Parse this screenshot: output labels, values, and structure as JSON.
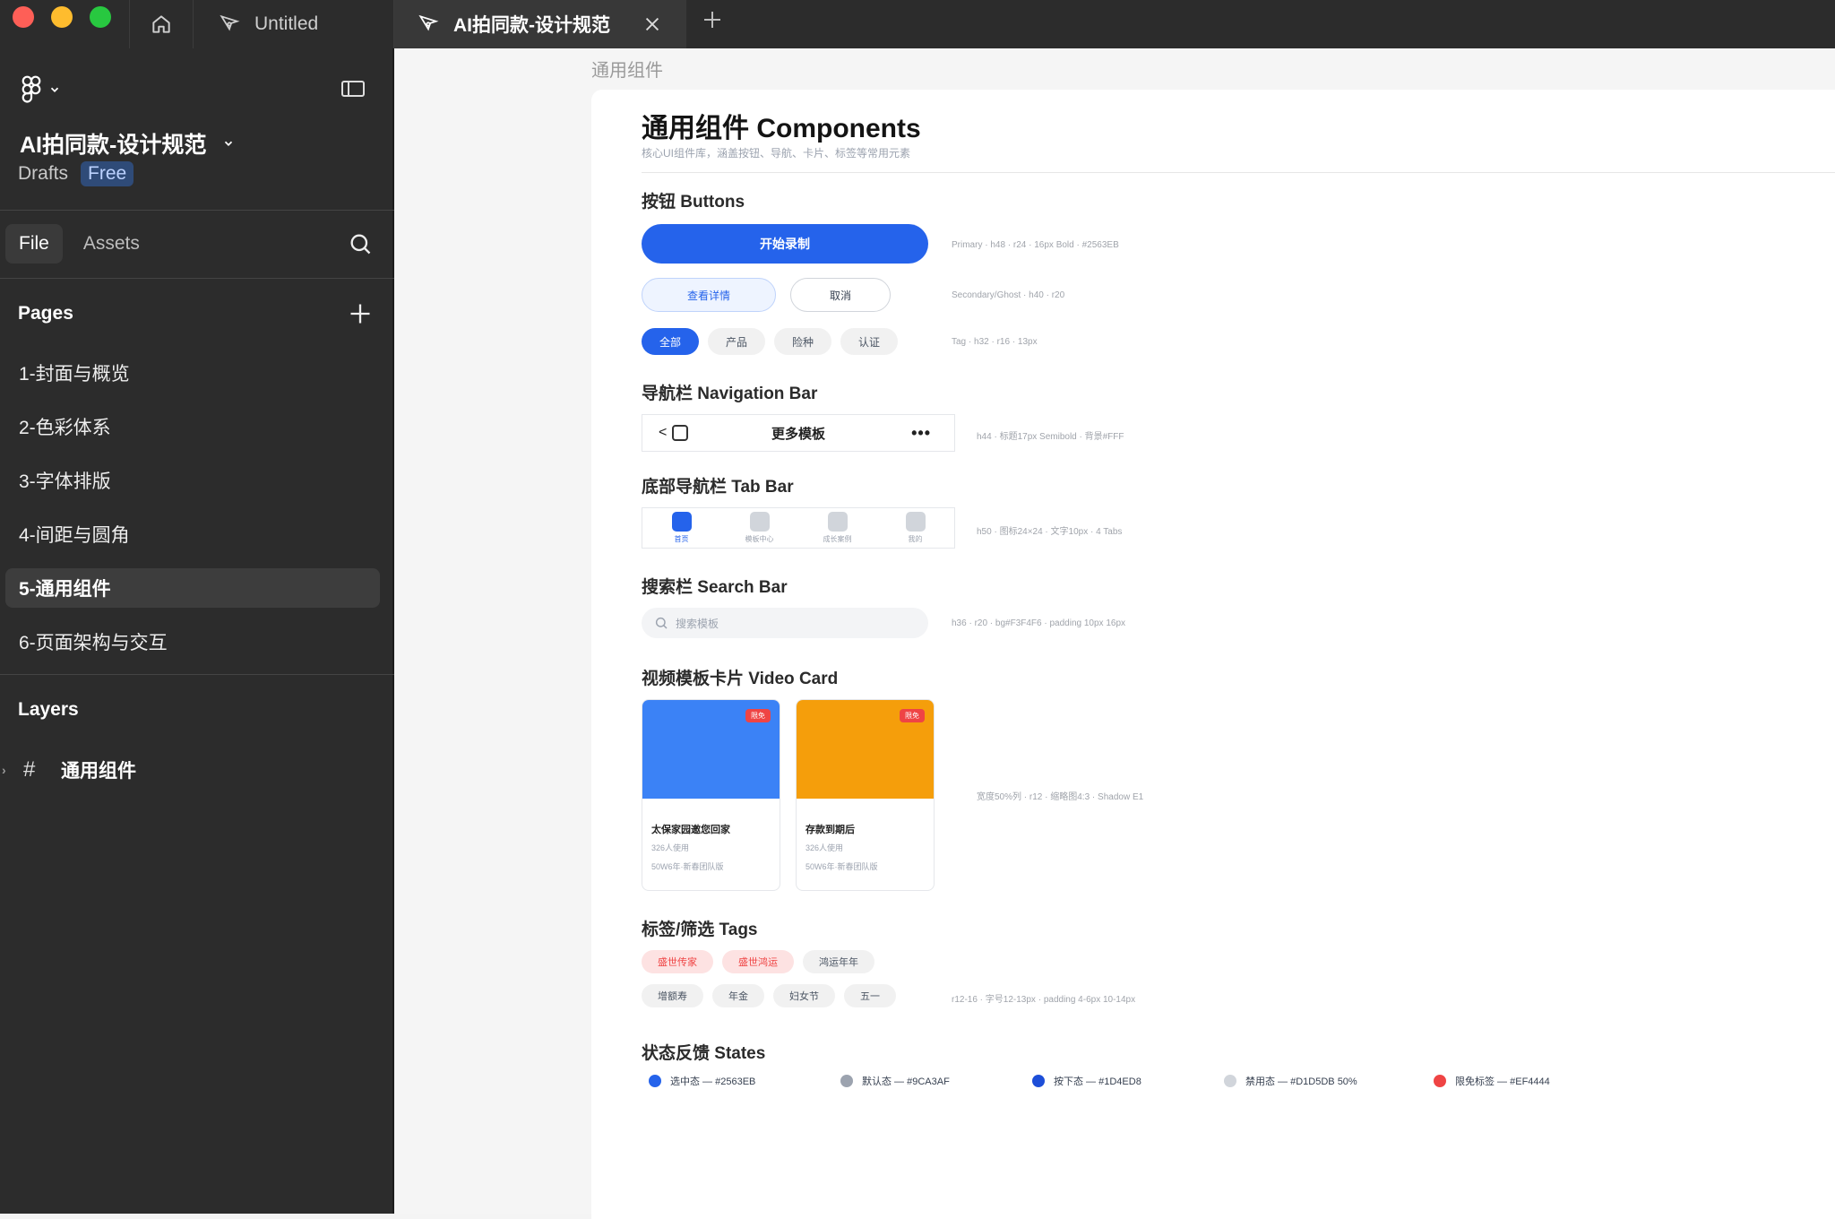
{
  "titlebar": {
    "tabs": [
      {
        "label": "Untitled"
      },
      {
        "label": "AI拍同款-设计规范"
      }
    ]
  },
  "sidebar": {
    "file_name": "AI拍同款-设计规范",
    "drafts": "Drafts",
    "plan_badge": "Free",
    "nav_tabs": [
      "File",
      "Assets"
    ],
    "pages_title": "Pages",
    "pages": [
      "1-封面与概览",
      "2-色彩体系",
      "3-字体排版",
      "4-间距与圆角",
      "5-通用组件",
      "6-页面架构与交互"
    ],
    "layers_title": "Layers",
    "layer": "通用组件"
  },
  "canvas": {
    "frame_label": "通用组件",
    "title": "通用组件 Components",
    "subtitle": "核心UI组件库，涵盖按钮、导航、卡片、标签等常用元素",
    "buttons": {
      "heading": "按钮 Buttons",
      "primary": "开始录制",
      "primary_spec": "Primary · h48 · r24 · 16px Bold · #2563EB",
      "secondary": "查看详情",
      "ghost": "取消",
      "secondary_spec": "Secondary/Ghost · h40 · r20",
      "tags": [
        "全部",
        "产品",
        "险种",
        "认证"
      ],
      "tag_spec": "Tag · h32 · r16 · 13px"
    },
    "navbar": {
      "heading": "导航栏 Navigation Bar",
      "back": "<",
      "title": "更多模板",
      "more": "•••",
      "spec": "h44 · 标题17px Semibold · 背景#FFF"
    },
    "tabbar": {
      "heading": "底部导航栏 Tab Bar",
      "items": [
        "首页",
        "模板中心",
        "成长案例",
        "我的"
      ],
      "spec": "h50 · 图标24×24 · 文字10px · 4 Tabs"
    },
    "search": {
      "heading": "搜索栏 Search Bar",
      "placeholder": "搜索模板",
      "spec": "h36 · r20 · bg#F3F4F6 · padding 10px 16px"
    },
    "video_card": {
      "heading": "视频模板卡片 Video Card",
      "cards": [
        {
          "badge": "限免",
          "title": "太保家园邀您回家",
          "users": "326人使用",
          "meta": "50W6年·新春团队版",
          "color": "#3b82f6"
        },
        {
          "badge": "限免",
          "title": "存款到期后",
          "users": "326人使用",
          "meta": "50W6年·新春团队版",
          "color": "#f59e0b"
        }
      ],
      "spec": "宽度50%列 · r12 · 缩略图4:3 · Shadow E1"
    },
    "tags": {
      "heading": "标签/筛选 Tags",
      "row1": [
        "盛世传家",
        "盛世鸿运",
        "鸿运年年"
      ],
      "row2": [
        "增额寿",
        "年金",
        "妇女节",
        "五一"
      ],
      "spec": "r12-16 · 字号12-13px · padding 4-6px 10-14px"
    },
    "states": {
      "heading": "状态反馈 States",
      "items": [
        {
          "label": "选中态 — #2563EB",
          "color": "#2563EB"
        },
        {
          "label": "默认态 — #9CA3AF",
          "color": "#9CA3AF"
        },
        {
          "label": "按下态 — #1D4ED8",
          "color": "#1D4ED8"
        },
        {
          "label": "禁用态 — #D1D5DB 50%",
          "color": "#D1D5DB"
        },
        {
          "label": "限免标签 — #EF4444",
          "color": "#EF4444"
        }
      ]
    }
  },
  "colors": {
    "accent": "#2563eb",
    "dark_bg": "#2c2c2c",
    "danger": "#ef4444"
  },
  "icons": [
    "home-icon",
    "figma-pen-icon",
    "close-icon",
    "plus-icon",
    "figma-logo-icon",
    "chevron-down-icon",
    "panel-toggle-icon",
    "search-icon",
    "frame-icon"
  ]
}
